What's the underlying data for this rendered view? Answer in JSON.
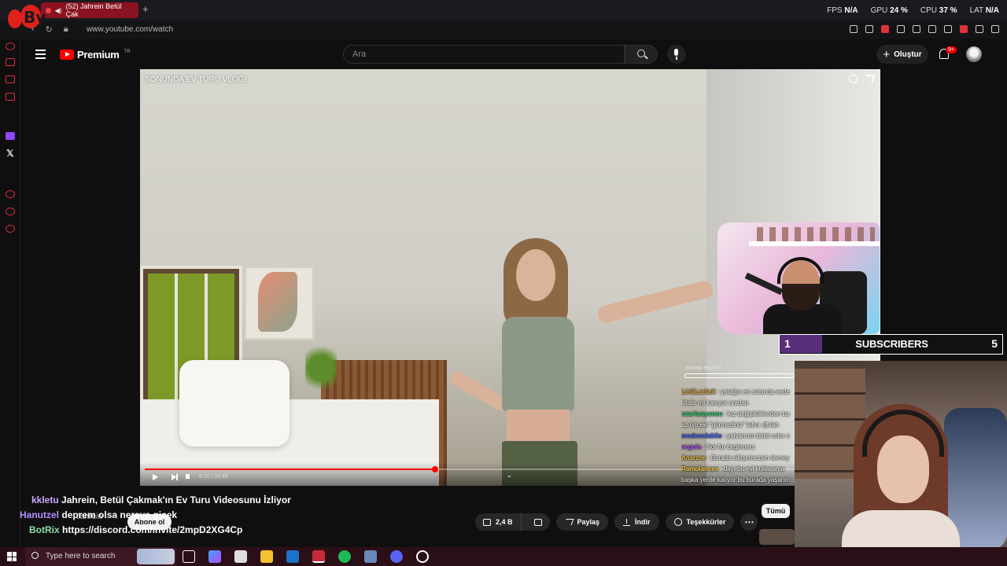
{
  "browser": {
    "tab_title": "(52) Jahrein Betül Çak",
    "url": "www.youtube.com/watch",
    "perf": [
      {
        "label": "FPS",
        "value": "N/A"
      },
      {
        "label": "GPU",
        "value": "24 %"
      },
      {
        "label": "CPU",
        "value": "37 %"
      },
      {
        "label": "LAT",
        "value": "N/A"
      }
    ],
    "logo_text": "By"
  },
  "youtube": {
    "logo_text": "Premium",
    "region": "TR",
    "search_placeholder": "Ara",
    "create_label": "Oluştur",
    "notifications_badge": "9+"
  },
  "video": {
    "title_overlay": "SONUNDA EV TURU VLOG!",
    "time": "8:10 / 20:44",
    "progress": 0.397
  },
  "overlay": {
    "subs_count": "1",
    "subs_label": "SUBSCRIBERS",
    "subs_goal": "5",
    "goal_title": "ABONE HEDEFİ",
    "chat": [
      {
        "user": "LiriliLarilaX",
        "color": "#e3b34a",
        "text": ": yatağın en solunda nede"
      },
      {
        "user": "",
        "color": "#ffffff",
        "text": "kitabı mı kasıyor oradan"
      },
      {
        "user": "ozurluoyuncu",
        "color": "#3fd67a",
        "text": ": kız değişikliklerden ba"
      },
      {
        "user": "",
        "color": "#ffffff",
        "text": "az önceki \"görmediniz\" lafını @Jah"
      },
      {
        "user": "modemdakilo",
        "color": "#4f6cff",
        "text": ": yalvarırım birisi color c"
      },
      {
        "user": "segula",
        "color": "#b45cff",
        "text": ": Not for beginners"
      },
      {
        "user": "Anarzee",
        "color": "#f0c24a",
        "text": ": Burada sikişemezsin demey"
      },
      {
        "user": "Ramolances",
        "color": "#ffd14a",
        "text": ": dayı bu evi kullanama"
      },
      {
        "user": "",
        "color": "#ffffff",
        "text": "başka yerde kalıyor bu burada yaşanm"
      }
    ]
  },
  "ticker": {
    "line1_name": "kkletu",
    "line1_text": "Jahrein, Betül Çakmak'ın Ev Turu Videosunu İzliyor",
    "line2_name": "Hanutzel",
    "line2_text": "deprem olsa nereye gicek",
    "line3_name": "BotRix",
    "line3_text": "https://discord.com/invite/2mpD2XG4Cp"
  },
  "below_video": {
    "channel": "Jahrein",
    "subscribe_label": "Abone ol",
    "like_count": "2,4 B",
    "share_label": "Paylaş",
    "download_label": "İndir",
    "thanks_label": "Teşekkürler",
    "more_label": "⋯",
    "all_label": "Tümü"
  },
  "taskbar": {
    "search_placeholder": "Type here to search"
  }
}
